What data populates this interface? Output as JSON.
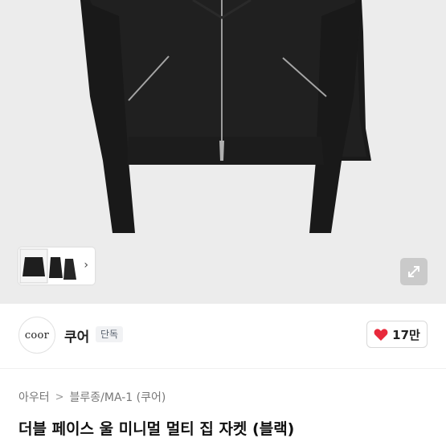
{
  "product": {
    "title": "더블 페이스 울 미니멀 멀티 집 자켓 (블랙)",
    "breadcrumb": [
      "아우터",
      "블루종/MA-1 (쿠어)"
    ]
  },
  "seller": {
    "logo_text": "coor",
    "name": "쿠어",
    "badge": "단독"
  },
  "likes": {
    "count": "17만"
  },
  "gallery": {
    "thumbnail_count": 3,
    "next_icon": "chevron-right-icon",
    "expand_icon": "expand-icon"
  },
  "colors": {
    "like_heart": "#e8293b",
    "badge_bg": "#f1f2f4",
    "image_bg": "#ececec"
  }
}
